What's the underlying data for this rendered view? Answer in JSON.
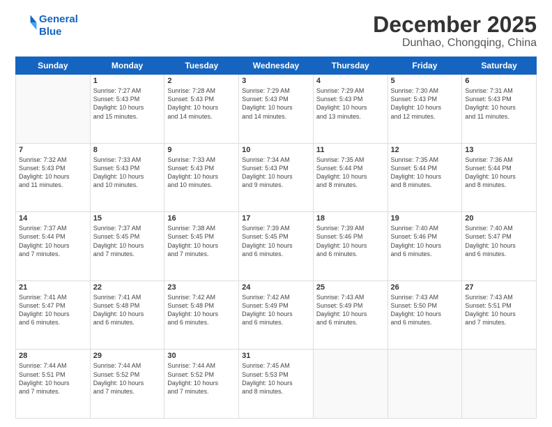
{
  "header": {
    "logo_line1": "General",
    "logo_line2": "Blue",
    "month": "December 2025",
    "location": "Dunhao, Chongqing, China"
  },
  "weekdays": [
    "Sunday",
    "Monday",
    "Tuesday",
    "Wednesday",
    "Thursday",
    "Friday",
    "Saturday"
  ],
  "weeks": [
    [
      {
        "day": "",
        "info": ""
      },
      {
        "day": "1",
        "info": "Sunrise: 7:27 AM\nSunset: 5:43 PM\nDaylight: 10 hours\nand 15 minutes."
      },
      {
        "day": "2",
        "info": "Sunrise: 7:28 AM\nSunset: 5:43 PM\nDaylight: 10 hours\nand 14 minutes."
      },
      {
        "day": "3",
        "info": "Sunrise: 7:29 AM\nSunset: 5:43 PM\nDaylight: 10 hours\nand 14 minutes."
      },
      {
        "day": "4",
        "info": "Sunrise: 7:29 AM\nSunset: 5:43 PM\nDaylight: 10 hours\nand 13 minutes."
      },
      {
        "day": "5",
        "info": "Sunrise: 7:30 AM\nSunset: 5:43 PM\nDaylight: 10 hours\nand 12 minutes."
      },
      {
        "day": "6",
        "info": "Sunrise: 7:31 AM\nSunset: 5:43 PM\nDaylight: 10 hours\nand 11 minutes."
      }
    ],
    [
      {
        "day": "7",
        "info": "Sunrise: 7:32 AM\nSunset: 5:43 PM\nDaylight: 10 hours\nand 11 minutes."
      },
      {
        "day": "8",
        "info": "Sunrise: 7:33 AM\nSunset: 5:43 PM\nDaylight: 10 hours\nand 10 minutes."
      },
      {
        "day": "9",
        "info": "Sunrise: 7:33 AM\nSunset: 5:43 PM\nDaylight: 10 hours\nand 10 minutes."
      },
      {
        "day": "10",
        "info": "Sunrise: 7:34 AM\nSunset: 5:43 PM\nDaylight: 10 hours\nand 9 minutes."
      },
      {
        "day": "11",
        "info": "Sunrise: 7:35 AM\nSunset: 5:44 PM\nDaylight: 10 hours\nand 8 minutes."
      },
      {
        "day": "12",
        "info": "Sunrise: 7:35 AM\nSunset: 5:44 PM\nDaylight: 10 hours\nand 8 minutes."
      },
      {
        "day": "13",
        "info": "Sunrise: 7:36 AM\nSunset: 5:44 PM\nDaylight: 10 hours\nand 8 minutes."
      }
    ],
    [
      {
        "day": "14",
        "info": "Sunrise: 7:37 AM\nSunset: 5:44 PM\nDaylight: 10 hours\nand 7 minutes."
      },
      {
        "day": "15",
        "info": "Sunrise: 7:37 AM\nSunset: 5:45 PM\nDaylight: 10 hours\nand 7 minutes."
      },
      {
        "day": "16",
        "info": "Sunrise: 7:38 AM\nSunset: 5:45 PM\nDaylight: 10 hours\nand 7 minutes."
      },
      {
        "day": "17",
        "info": "Sunrise: 7:39 AM\nSunset: 5:45 PM\nDaylight: 10 hours\nand 6 minutes."
      },
      {
        "day": "18",
        "info": "Sunrise: 7:39 AM\nSunset: 5:46 PM\nDaylight: 10 hours\nand 6 minutes."
      },
      {
        "day": "19",
        "info": "Sunrise: 7:40 AM\nSunset: 5:46 PM\nDaylight: 10 hours\nand 6 minutes."
      },
      {
        "day": "20",
        "info": "Sunrise: 7:40 AM\nSunset: 5:47 PM\nDaylight: 10 hours\nand 6 minutes."
      }
    ],
    [
      {
        "day": "21",
        "info": "Sunrise: 7:41 AM\nSunset: 5:47 PM\nDaylight: 10 hours\nand 6 minutes."
      },
      {
        "day": "22",
        "info": "Sunrise: 7:41 AM\nSunset: 5:48 PM\nDaylight: 10 hours\nand 6 minutes."
      },
      {
        "day": "23",
        "info": "Sunrise: 7:42 AM\nSunset: 5:48 PM\nDaylight: 10 hours\nand 6 minutes."
      },
      {
        "day": "24",
        "info": "Sunrise: 7:42 AM\nSunset: 5:49 PM\nDaylight: 10 hours\nand 6 minutes."
      },
      {
        "day": "25",
        "info": "Sunrise: 7:43 AM\nSunset: 5:49 PM\nDaylight: 10 hours\nand 6 minutes."
      },
      {
        "day": "26",
        "info": "Sunrise: 7:43 AM\nSunset: 5:50 PM\nDaylight: 10 hours\nand 6 minutes."
      },
      {
        "day": "27",
        "info": "Sunrise: 7:43 AM\nSunset: 5:51 PM\nDaylight: 10 hours\nand 7 minutes."
      }
    ],
    [
      {
        "day": "28",
        "info": "Sunrise: 7:44 AM\nSunset: 5:51 PM\nDaylight: 10 hours\nand 7 minutes."
      },
      {
        "day": "29",
        "info": "Sunrise: 7:44 AM\nSunset: 5:52 PM\nDaylight: 10 hours\nand 7 minutes."
      },
      {
        "day": "30",
        "info": "Sunrise: 7:44 AM\nSunset: 5:52 PM\nDaylight: 10 hours\nand 7 minutes."
      },
      {
        "day": "31",
        "info": "Sunrise: 7:45 AM\nSunset: 5:53 PM\nDaylight: 10 hours\nand 8 minutes."
      },
      {
        "day": "",
        "info": ""
      },
      {
        "day": "",
        "info": ""
      },
      {
        "day": "",
        "info": ""
      }
    ]
  ]
}
